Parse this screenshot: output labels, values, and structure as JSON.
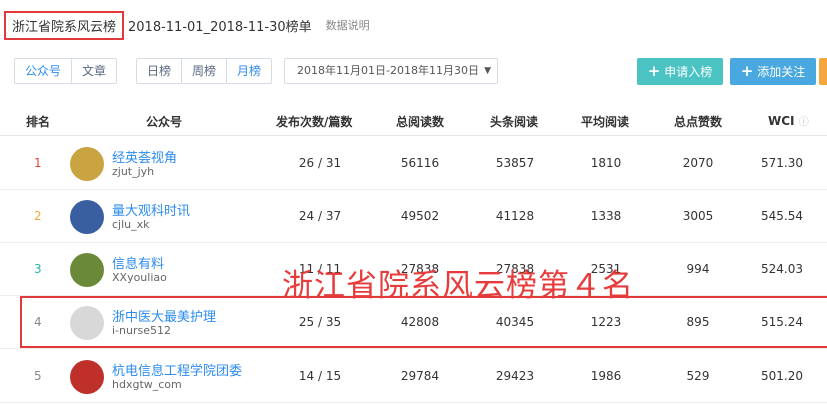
{
  "header": {
    "title": "浙江省院系风云榜",
    "dates": "2018-11-01_2018-11-30榜单",
    "note": "数据说明"
  },
  "controls": {
    "type_tabs": [
      "公众号",
      "文章"
    ],
    "period_tabs": [
      "日榜",
      "周榜",
      "月榜"
    ],
    "active_period": "月榜",
    "date_range": "2018年11月01日-2018年11月30日",
    "apply_label": "申请入榜",
    "follow_label": "添加关注",
    "plus_icon": "plus-icon",
    "caret_icon": "caret-down-icon"
  },
  "table": {
    "headers": {
      "rank": "排名",
      "account": "公众号",
      "publish": "发布次数/篇数",
      "total_reads": "总阅读数",
      "headline_reads": "头条阅读",
      "avg_reads": "平均阅读",
      "likes": "总点赞数",
      "wci": "WCI"
    },
    "rows": [
      {
        "rank": "1",
        "name": "经英荟视角",
        "id": "zjut_jyh",
        "publish": "26 / 31",
        "total": "56116",
        "headline": "53857",
        "avg": "1810",
        "likes": "2070",
        "wci": "571.30",
        "rank_color": "#e0453a",
        "avatar_color": "#c9a441"
      },
      {
        "rank": "2",
        "name": "量大观科时讯",
        "id": "cjlu_xk",
        "publish": "24 / 37",
        "total": "49502",
        "headline": "41128",
        "avg": "1338",
        "likes": "3005",
        "wci": "545.54",
        "rank_color": "#f0a83a",
        "avatar_color": "#3a5fa0"
      },
      {
        "rank": "3",
        "name": "信息有料",
        "id": "XXyouliao",
        "publish": "11 / 11",
        "total": "27838",
        "headline": "27838",
        "avg": "2531",
        "likes": "994",
        "wci": "524.03",
        "rank_color": "#2bb3a3",
        "avatar_color": "#6a8a3a"
      },
      {
        "rank": "4",
        "name": "浙中医大最美护理",
        "id": "i-nurse512",
        "publish": "25 / 35",
        "total": "42808",
        "headline": "40345",
        "avg": "1223",
        "likes": "895",
        "wci": "515.24",
        "rank_color": "#888888",
        "avatar_color": "#d8d8d8"
      },
      {
        "rank": "5",
        "name": "杭电信息工程学院团委",
        "id": "hdxgtw_com",
        "publish": "14 / 15",
        "total": "29784",
        "headline": "29423",
        "avg": "1986",
        "likes": "529",
        "wci": "501.20",
        "rank_color": "#888888",
        "avatar_color": "#c0302a"
      }
    ]
  },
  "overlay": {
    "text": "浙江省院系风云榜第４名"
  }
}
